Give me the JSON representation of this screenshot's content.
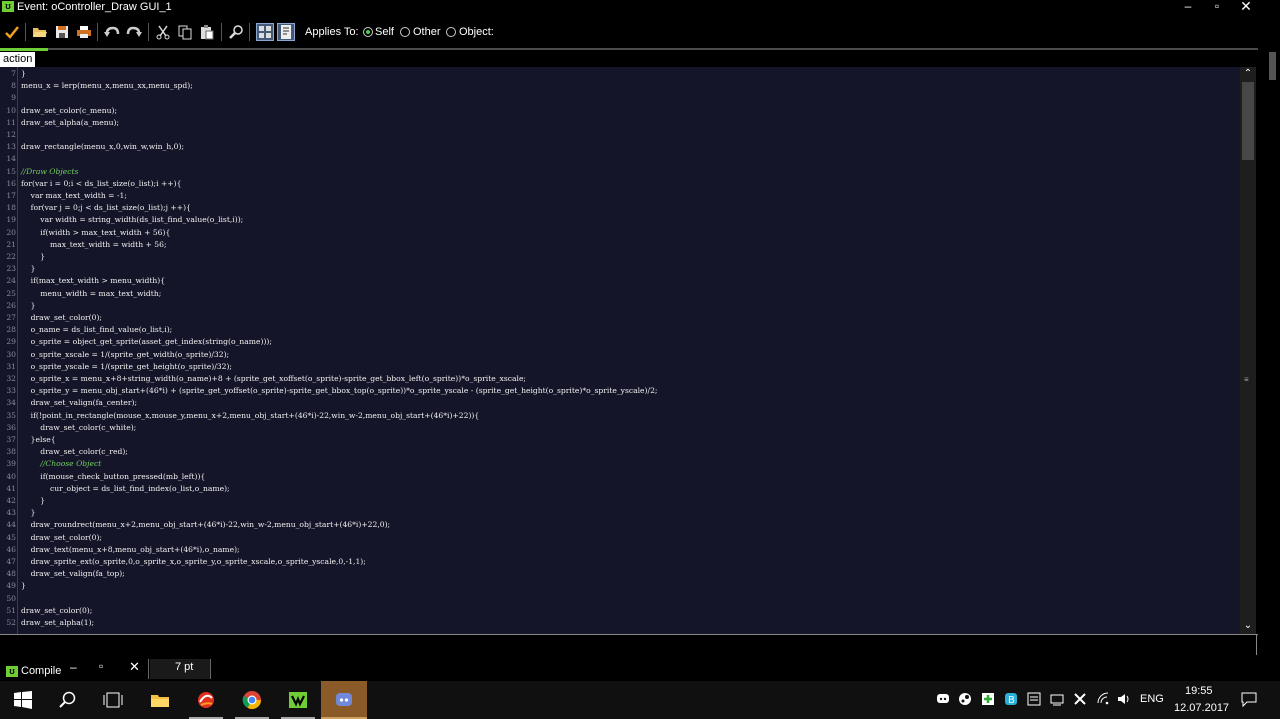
{
  "window": {
    "title": "Event: oController_Draw GUI_1",
    "controls": [
      "minimize",
      "maximize",
      "close"
    ]
  },
  "toolbar": {
    "buttons": [
      "checkmark-icon",
      "open-icon",
      "save-icon",
      "print-icon",
      "undo-icon",
      "redo-icon",
      "cut-icon",
      "copy-icon",
      "paste-icon",
      "search-icon",
      "code-layout-icon",
      "code-file-icon"
    ],
    "applies_to_label": "Applies To:",
    "options": [
      {
        "label": "Self",
        "selected": true
      },
      {
        "label": "Other",
        "selected": false
      },
      {
        "label": "Object:",
        "selected": false
      }
    ]
  },
  "tab": {
    "label": "action"
  },
  "editor": {
    "lines": [
      {
        "n": "7",
        "code": "}"
      },
      {
        "n": "8",
        "code": "menu_x = lerp(menu_x,menu_xx,menu_spd);"
      },
      {
        "n": "9",
        "code": ""
      },
      {
        "n": "10",
        "code": "draw_set_color(c_menu);"
      },
      {
        "n": "11",
        "code": "draw_set_alpha(a_menu);"
      },
      {
        "n": "12",
        "code": ""
      },
      {
        "n": "13",
        "code": "draw_rectangle(menu_x,0,win_w,win_h,0);"
      },
      {
        "n": "14",
        "code": ""
      },
      {
        "n": "15",
        "code": "//Draw Objects",
        "comment": true
      },
      {
        "n": "16",
        "code": "for(var i = 0;i < ds_list_size(o_list);i ++){"
      },
      {
        "n": "17",
        "code": "    var max_text_width = -1;"
      },
      {
        "n": "18",
        "code": "    for(var j = 0;j < ds_list_size(o_list);j ++){"
      },
      {
        "n": "19",
        "code": "        var width = string_width(ds_list_find_value(o_list,i));"
      },
      {
        "n": "20",
        "code": "        if(width > max_text_width + 56){"
      },
      {
        "n": "21",
        "code": "            max_text_width = width + 56;"
      },
      {
        "n": "22",
        "code": "        }"
      },
      {
        "n": "23",
        "code": "    }"
      },
      {
        "n": "24",
        "code": "    if(max_text_width > menu_width){"
      },
      {
        "n": "25",
        "code": "        menu_width = max_text_width;"
      },
      {
        "n": "26",
        "code": "    }"
      },
      {
        "n": "27",
        "code": "    draw_set_color(0);"
      },
      {
        "n": "28",
        "code": "    o_name = ds_list_find_value(o_list,i);"
      },
      {
        "n": "29",
        "code": "    o_sprite = object_get_sprite(asset_get_index(string(o_name)));"
      },
      {
        "n": "30",
        "code": "    o_sprite_xscale = 1/(sprite_get_width(o_sprite)/32);"
      },
      {
        "n": "31",
        "code": "    o_sprite_yscale = 1/(sprite_get_height(o_sprite)/32);"
      },
      {
        "n": "32",
        "code": "    o_sprite_x = menu_x+8+string_width(o_name)+8 + (sprite_get_xoffset(o_sprite)-sprite_get_bbox_left(o_sprite))*o_sprite_xscale;"
      },
      {
        "n": "33",
        "code": "    o_sprite_y = menu_obj_start+(46*i) + (sprite_get_yoffset(o_sprite)-sprite_get_bbox_top(o_sprite))*o_sprite_yscale - (sprite_get_height(o_sprite)*o_sprite_yscale)/2;"
      },
      {
        "n": "34",
        "code": "    draw_set_valign(fa_center);"
      },
      {
        "n": "35",
        "code": "    if(!point_in_rectangle(mouse_x,mouse_y,menu_x+2,menu_obj_start+(46*i)-22,win_w-2,menu_obj_start+(46*i)+22)){"
      },
      {
        "n": "36",
        "code": "        draw_set_color(c_white);"
      },
      {
        "n": "37",
        "code": "    }else{"
      },
      {
        "n": "38",
        "code": "        draw_set_color(c_red);"
      },
      {
        "n": "39",
        "code": "        //Choose Object",
        "comment": true
      },
      {
        "n": "40",
        "code": "        if(mouse_check_button_pressed(mb_left)){"
      },
      {
        "n": "41",
        "code": "            cur_object = ds_list_find_index(o_list,o_name);"
      },
      {
        "n": "42",
        "code": "        }"
      },
      {
        "n": "43",
        "code": "    }"
      },
      {
        "n": "44",
        "code": "    draw_roundrect(menu_x+2,menu_obj_start+(46*i)-22,win_w-2,menu_obj_start+(46*i)+22,0);"
      },
      {
        "n": "45",
        "code": "    draw_set_color(0);"
      },
      {
        "n": "46",
        "code": "    draw_text(menu_x+8,menu_obj_start+(46*i),o_name);"
      },
      {
        "n": "47",
        "code": "    draw_sprite_ext(o_sprite,0,o_sprite_x,o_sprite_y,o_sprite_xscale,o_sprite_yscale,0,-1,1);"
      },
      {
        "n": "48",
        "code": "    draw_set_valign(fa_top);"
      },
      {
        "n": "49",
        "code": "}"
      },
      {
        "n": "50",
        "code": ""
      },
      {
        "n": "51",
        "code": "draw_set_color(0);"
      },
      {
        "n": "52",
        "code": "draw_set_alpha(1);"
      }
    ]
  },
  "status": {
    "compile_label": "Compile",
    "font_size": "7 pt"
  },
  "taskbar": {
    "apps": [
      "windows-start-icon",
      "search-icon",
      "task-view-icon",
      "file-explorer-icon",
      "app-icon",
      "chrome-icon",
      "gamemaker-icon",
      "discord-icon"
    ],
    "language": "ENG",
    "time": "19:55",
    "date": "12.07.2017"
  }
}
